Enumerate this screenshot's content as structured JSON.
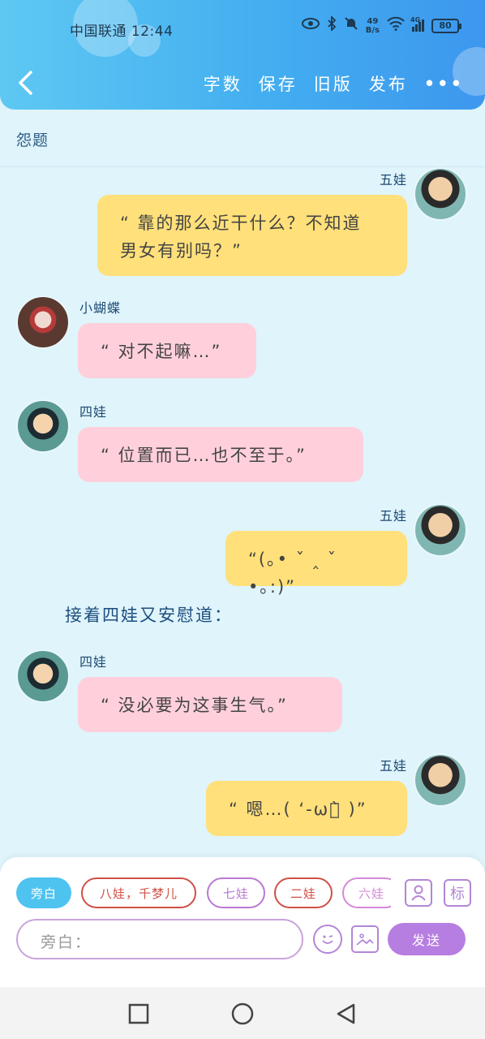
{
  "status_bar": {
    "carrier_time": "中国联通 12:44",
    "net_speed_top": "49",
    "net_speed_bottom": "B/s",
    "network": "4G",
    "battery": "80"
  },
  "nav": {
    "actions": [
      "字数",
      "保存",
      "旧版",
      "发布"
    ],
    "more": "•••"
  },
  "chapter_title": "怨题",
  "messages": [
    {
      "side": "right",
      "name": "五娃",
      "text": "“ 靠的那么近干什么？不知道\n男女有别吗？”",
      "color": "yellow",
      "avatar": "wuwa-avatar"
    },
    {
      "side": "left",
      "name": "小蝴蝶",
      "text": "“ 对不起嘛…”",
      "color": "pink",
      "avatar": "butterfly-avatar"
    },
    {
      "side": "left",
      "name": "四娃",
      "text": "“ 位置而已…也不至于。”",
      "color": "pink",
      "avatar": "siwa-avatar"
    },
    {
      "side": "right",
      "name": "五娃",
      "text": "“(｡• ˇ ‸ ˇ •｡:)”",
      "color": "yellow",
      "avatar": "wuwa-avatar"
    },
    {
      "side": "left",
      "name": "四娃",
      "text": "“ 没必要为这事生气。”",
      "color": "pink",
      "avatar": "siwa-avatar"
    },
    {
      "side": "right",
      "name": "五娃",
      "text": "“ 嗯…( ‘-ωก̀ )”",
      "color": "yellow",
      "avatar": "wuwa-avatar"
    }
  ],
  "narration": "接着四娃又安慰道：",
  "composer": {
    "roles": [
      "旁白",
      "八娃，千梦儿",
      "七娃",
      "二娃",
      "六娃"
    ],
    "person_icon": "person-icon",
    "tag_label": "标",
    "input_placeholder": "旁白：",
    "send_label": "发送"
  },
  "colors": {
    "header_start": "#5ec8f3",
    "header_end": "#3d97ee",
    "bubble_yellow": "#ffe07a",
    "bubble_pink": "#ffd0dc",
    "send_purple": "#b77ee2",
    "active_chip": "#4ec3f0"
  }
}
